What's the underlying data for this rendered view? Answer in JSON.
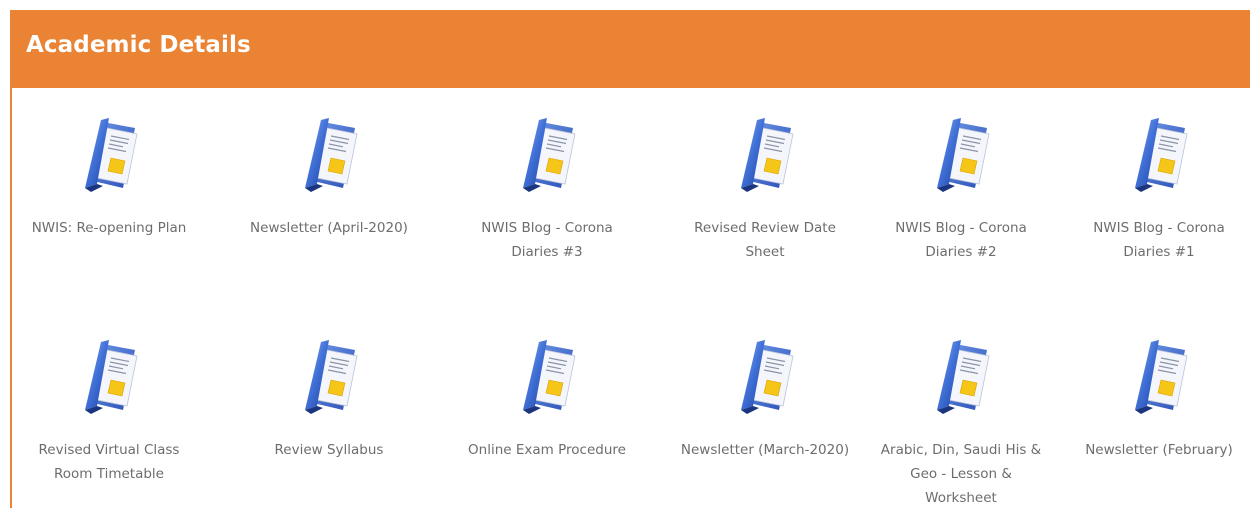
{
  "panel": {
    "title": "Academic Details",
    "accent_color": "#ea8434",
    "icon": "document-folder-icon"
  },
  "items": [
    {
      "label": "NWIS: Re-opening Plan"
    },
    {
      "label": "Newsletter (April-2020)"
    },
    {
      "label": "NWIS Blog - Corona Diaries #3"
    },
    {
      "label": "Revised Review Date Sheet"
    },
    {
      "label": "NWIS Blog - Corona Diaries #2"
    },
    {
      "label": "NWIS Blog - Corona Diaries #1"
    },
    {
      "label": "Revised Virtual Class Room Timetable"
    },
    {
      "label": "Review Syllabus"
    },
    {
      "label": "Online Exam Procedure"
    },
    {
      "label": "Newsletter (March-2020)"
    },
    {
      "label": "Arabic, Din, Saudi His & Geo - Lesson & Worksheet"
    },
    {
      "label": "Newsletter (February)"
    }
  ]
}
